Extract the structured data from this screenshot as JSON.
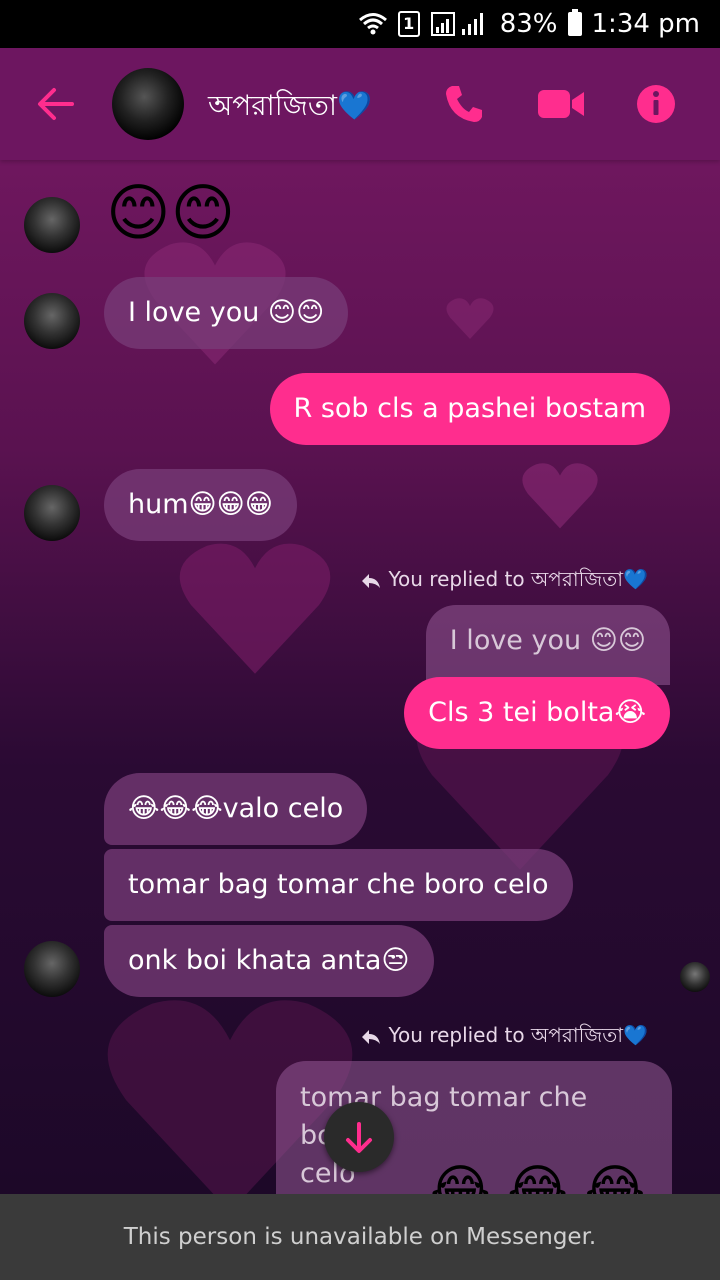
{
  "status_bar": {
    "battery": "83%",
    "time": "1:34 pm",
    "sim": "1"
  },
  "header": {
    "contact_name": "অপরাজিতা💙"
  },
  "messages": {
    "m1": "😊😊",
    "m2": "I love you 😊😊",
    "m3": "R sob cls a pashei bostam",
    "m4": "hum😁😁😁",
    "reply_note_1": "You replied to অপরাজিতা💙",
    "quoted_1": "I love you 😊😊",
    "m5": "Cls 3 tei bolta😭",
    "m6": "😂😂😂valo celo",
    "m7": "tomar bag tomar che boro celo",
    "m8": "onk boi khata anta😒",
    "reply_note_2": "You replied to অপরাজিতা💙",
    "quoted_2_line1": "tomar bag tomar che boro",
    "quoted_2_line2": "celo",
    "m9": "😂 😂 😂"
  },
  "footer": {
    "text": "This person is unavailable on Messenger."
  },
  "colors": {
    "accent": "#ff2d8e",
    "header": "#6d1660",
    "incoming": "#7a3c78"
  },
  "icons": [
    "back-arrow-icon",
    "phone-icon",
    "video-camera-icon",
    "info-icon",
    "reply-arrow-icon",
    "arrow-down-icon",
    "wifi-icon",
    "signal-icon",
    "battery-icon"
  ]
}
